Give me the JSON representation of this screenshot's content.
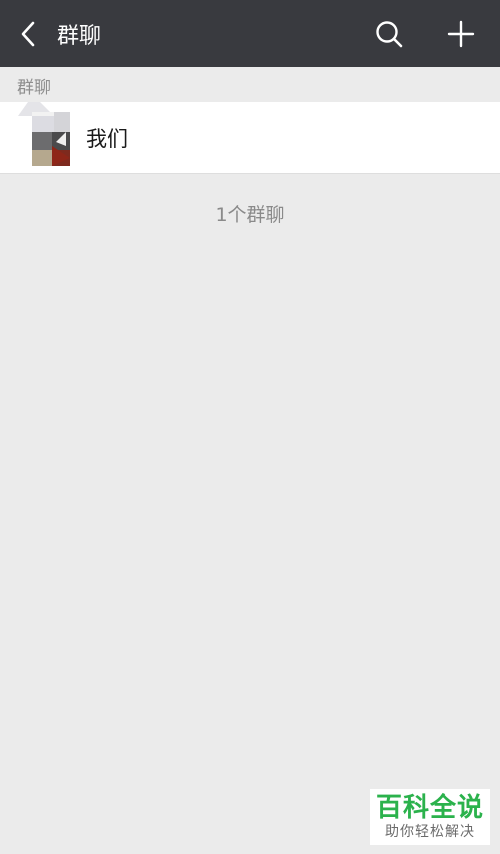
{
  "header": {
    "title": "群聊",
    "back_icon": "chevron-left-icon",
    "search_icon": "search-icon",
    "add_icon": "plus-icon",
    "background": "#393a3f"
  },
  "section": {
    "title": "群聊"
  },
  "groups": [
    {
      "name": "我们",
      "avatar": "group-avatar-icon"
    }
  ],
  "footer": {
    "count_text": "1个群聊"
  },
  "watermark": {
    "main": "百科全说",
    "sub": "助你轻松解决",
    "color": "#2bb24c"
  }
}
